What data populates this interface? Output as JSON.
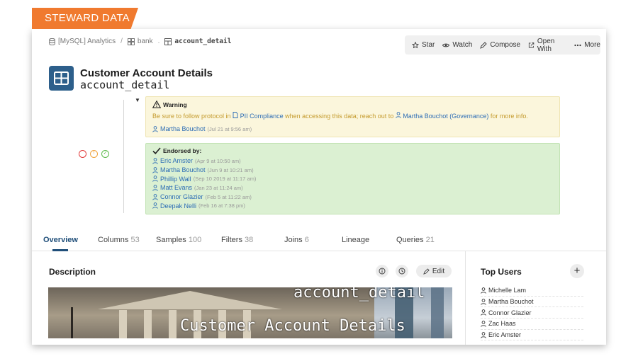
{
  "ribbon": "STEWARD DATA",
  "breadcrumb": {
    "database": "[MySQL] Analytics",
    "schema": "bank",
    "dot": ".",
    "table": "account_detail",
    "separator": "/"
  },
  "toolbar": {
    "star": "Star",
    "watch": "Watch",
    "compose": "Compose",
    "open_with": "Open With",
    "more": "More"
  },
  "header": {
    "title": "Customer Account Details",
    "subtitle": "account_detail"
  },
  "warning": {
    "heading": "Warning",
    "text_before": "Be sure to follow protocol in",
    "link_doc": "PII Compliance",
    "text_middle": "when accessing this data; reach out to",
    "link_person": "Martha Bouchot (Governance)",
    "text_after": "for more info.",
    "author": "Martha Bouchot",
    "author_when": "(Jul 21 at 9:56 am)"
  },
  "endorsed": {
    "heading": "Endorsed by:",
    "people": [
      {
        "name": "Eric Amster",
        "when": "(Apr 9 at 10:50 am)"
      },
      {
        "name": "Martha Bouchot",
        "when": "(Jun 9 at 10:21 am)"
      },
      {
        "name": "Phillip Wall",
        "when": "(Sep 10 2019 at 11:17 am)"
      },
      {
        "name": "Matt Evans",
        "when": "(Jan 23 at 11:24 am)"
      },
      {
        "name": "Connor Glazier",
        "when": "(Feb 5 at 11:22 am)"
      },
      {
        "name": "Deepak Nelli",
        "when": "(Feb 16 at 7:38 pm)"
      }
    ]
  },
  "status_colors": {
    "red": "#e23b3b",
    "orange": "#f0a23a",
    "green": "#5dbb4b"
  },
  "tabs": [
    {
      "label": "Overview",
      "count": ""
    },
    {
      "label": "Columns",
      "count": "53"
    },
    {
      "label": "Samples",
      "count": "100"
    },
    {
      "label": "Filters",
      "count": "38"
    },
    {
      "label": "Joins",
      "count": "6"
    },
    {
      "label": "Lineage",
      "count": ""
    },
    {
      "label": "Queries",
      "count": "21"
    }
  ],
  "description": {
    "heading": "Description",
    "edit_label": "Edit",
    "banner_line1": "account_detail",
    "banner_line2": "Customer Account Details"
  },
  "top_users": {
    "heading": "Top Users",
    "add": "+",
    "users": [
      "Michelle Lam",
      "Martha Bouchot",
      "Connor Glazier",
      "Zac Haas",
      "Eric Amster"
    ]
  }
}
